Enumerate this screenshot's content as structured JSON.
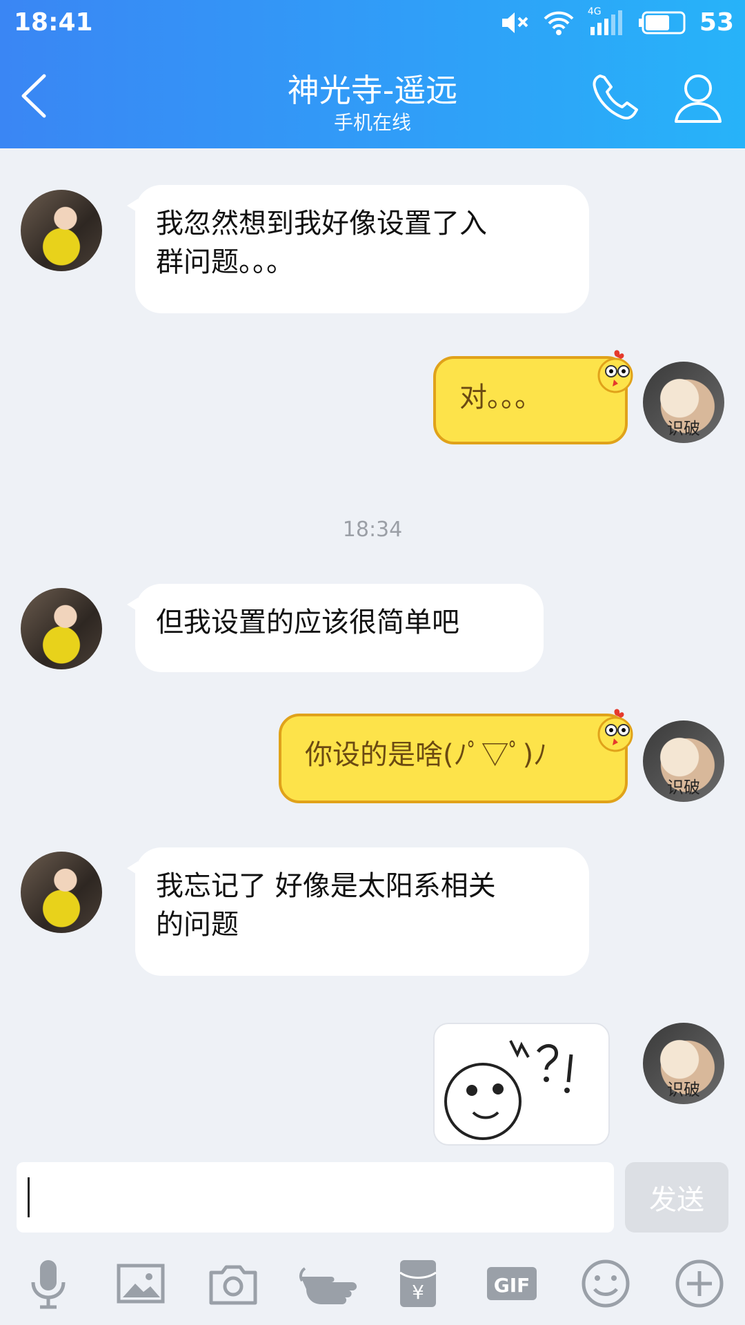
{
  "status_bar": {
    "time": "18:41",
    "battery": "53",
    "network": "4G"
  },
  "nav": {
    "title": "神光寺-遥远",
    "subtitle": "手机在线"
  },
  "messages": [
    {
      "from": "peer",
      "text_line1": "我忽然想到我好像设置了入",
      "text_line2": "群问题。。。"
    },
    {
      "from": "me",
      "text": "对。。。"
    },
    {
      "from": "peer",
      "text": "但我设置的应该很简单吧"
    },
    {
      "from": "me",
      "text": "你设的是啥(ﾉﾟ▽ﾟ)ﾉ"
    },
    {
      "from": "peer",
      "text_line1": "我忘记了 好像是太阳系相关",
      "text_line2": "的问题"
    }
  ],
  "timestamp": "18:34",
  "avatar_caption": "识破",
  "input": {
    "value": "",
    "send_label": "发送"
  },
  "toolbar": {
    "icons": [
      "microphone-icon",
      "image-icon",
      "camera-icon",
      "poke-hand-icon",
      "red-packet-icon",
      "gif-icon",
      "emoji-icon",
      "plus-icon"
    ],
    "gif_label": "GIF",
    "red_packet_glyph": "¥"
  },
  "colors": {
    "header_start": "#3a86f4",
    "header_end": "#27b3f9",
    "out_bubble": "#fde34a",
    "background": "#eef1f6"
  }
}
